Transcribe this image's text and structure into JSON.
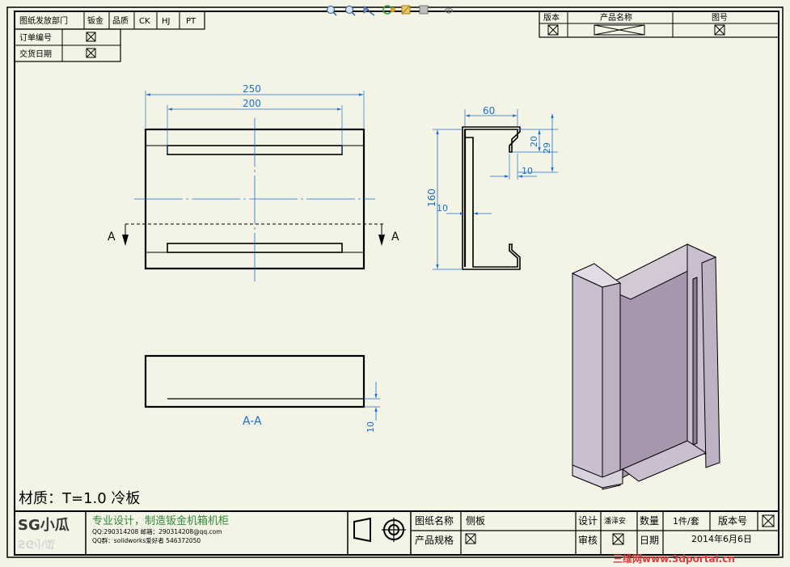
{
  "header": {
    "dept_label": "图纸发放部门",
    "dept_cells": [
      "钣金",
      "品质",
      "CK",
      "HJ",
      "PT"
    ],
    "order_no_label": "订单编号",
    "delivery_label": "交货日期"
  },
  "top_right": {
    "version_label": "版本",
    "product_name_label": "产品名称",
    "drawing_no_label": "图号"
  },
  "toolbar": {
    "icons": [
      "zoom-to-fit-icon",
      "zoom-area-icon",
      "previous-view-icon",
      "rotate-view-icon",
      "section-view-icon",
      "display-style-icon",
      "hide-show-icon"
    ]
  },
  "front_view": {
    "dim_overall": "250",
    "dim_inner": "200",
    "section_label": "A"
  },
  "side_view": {
    "dim_width": "60",
    "dim_height": "160",
    "dim_flange": "20",
    "dim_flange_total": "29",
    "dim_return": "10",
    "dim_wall": "10"
  },
  "section_view": {
    "dim_height": "10",
    "caption": "A-A"
  },
  "material": "材质：T=1.0 冷板",
  "title_block": {
    "logo": "SG小瓜",
    "slogan": "专业设计，制造钣金机箱机柜",
    "contact_line1": "QQ:290314208 邮箱：290314208@qq.com",
    "contact_line2": "QQ群：solidworks爱好者 546372050",
    "drawing_name_label": "图纸名称",
    "drawing_name_value": "侧板",
    "spec_label": "产品规格",
    "design_label": "设计",
    "designer": "潘泽安",
    "review_label": "审核",
    "quantity_label": "数量",
    "quantity_value": "1件/套",
    "date_label": "日期",
    "date_value": "2014年6月6日",
    "version_label": "版本号"
  },
  "watermark": "三维网www.3dportal.cn",
  "colors": {
    "dimension": "#1a6fd1",
    "part_face": "#a896ae",
    "part_side": "#c9bfd0",
    "sheet_bg": "#f4f4e6"
  }
}
